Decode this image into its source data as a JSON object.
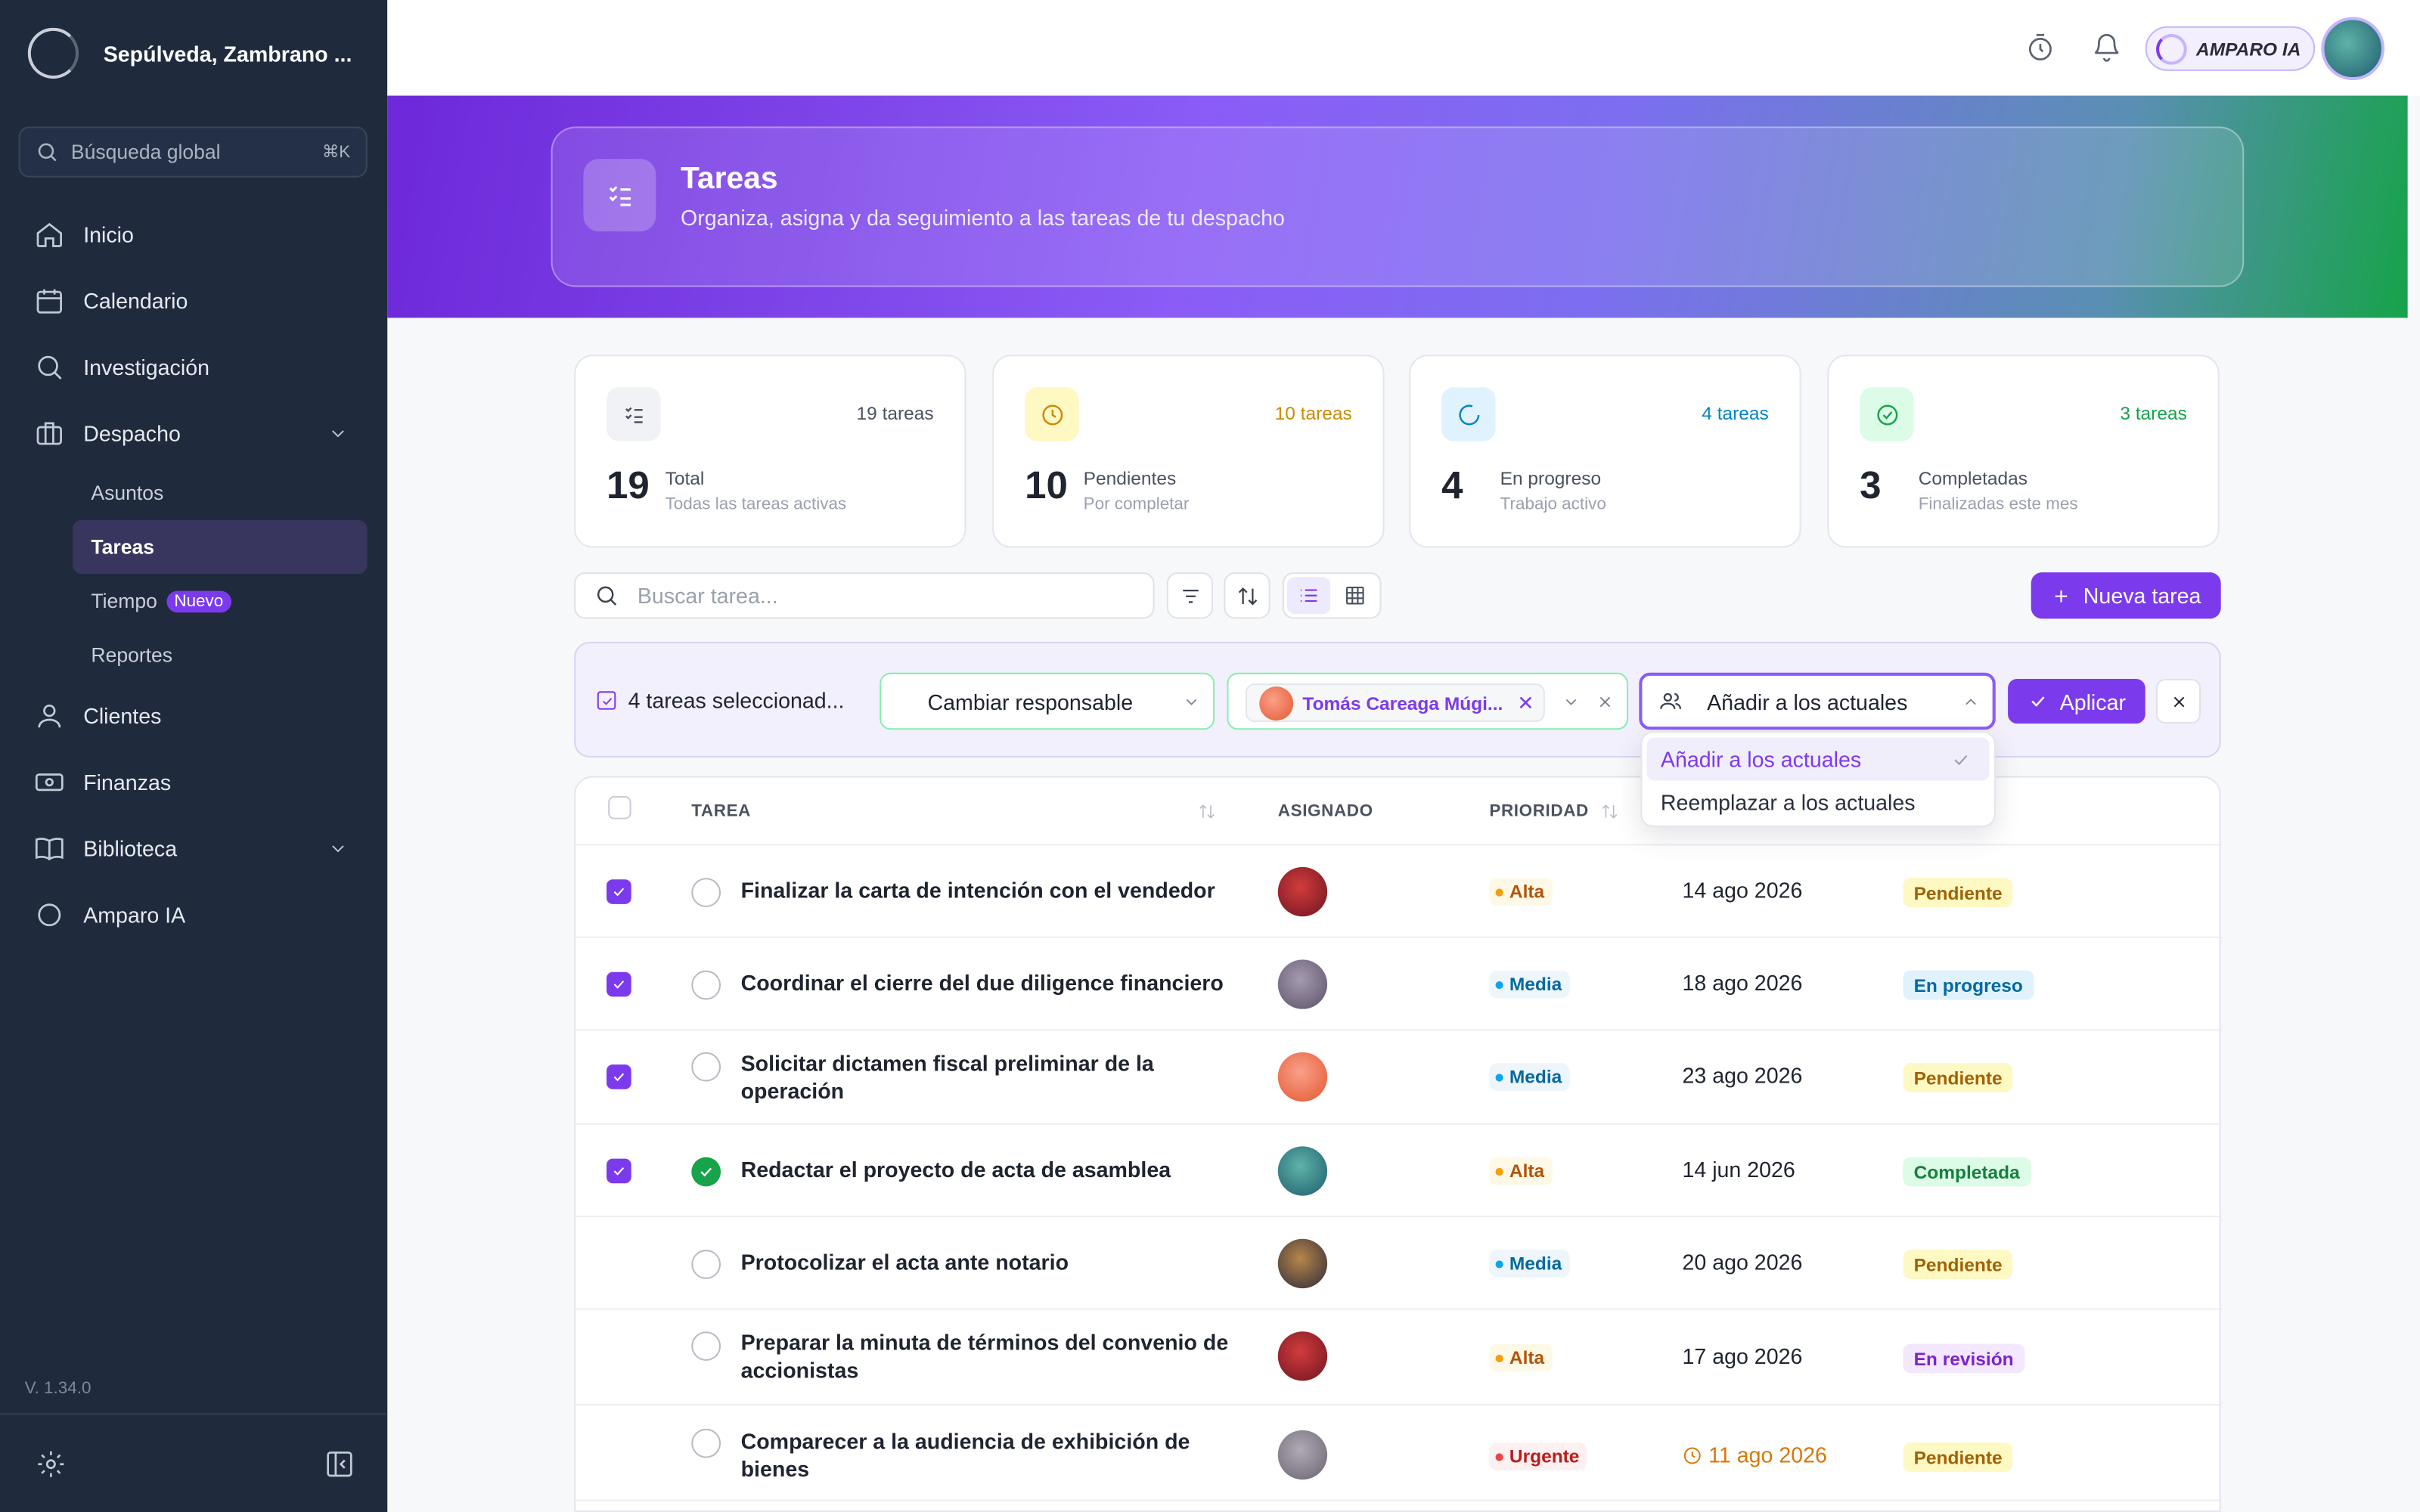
{
  "sidebar": {
    "brand": "Sepúlveda, Zambrano ...",
    "search_label": "Búsqueda global",
    "search_kbd": "⌘K",
    "nav": [
      {
        "label": "Inicio",
        "icon": "home-icon"
      },
      {
        "label": "Calendario",
        "icon": "calendar-icon"
      },
      {
        "label": "Investigación",
        "icon": "search-icon"
      },
      {
        "label": "Despacho",
        "icon": "briefcase-icon"
      }
    ],
    "despacho_sub": [
      {
        "label": "Asuntos"
      },
      {
        "label": "Tareas"
      },
      {
        "label": "Tiempo",
        "badge": "Nuevo"
      },
      {
        "label": "Reportes"
      }
    ],
    "nav2": [
      {
        "label": "Clientes",
        "icon": "user-icon"
      },
      {
        "label": "Finanzas",
        "icon": "cash-icon"
      },
      {
        "label": "Biblioteca",
        "icon": "book-icon"
      },
      {
        "label": "Amparo IA",
        "icon": "ring-icon"
      }
    ],
    "version": "V. 1.34.0"
  },
  "topbar": {
    "amparo_label": "AMPARO IA"
  },
  "hero": {
    "title": "Tareas",
    "subtitle": "Organiza, asigna y da seguimiento a las tareas de tu despacho"
  },
  "stats": [
    {
      "count": "19 tareas",
      "num": "19",
      "label": "Total",
      "sub": "Todas las tareas activas",
      "color": "#4b5260",
      "bg": "#f1f2f5"
    },
    {
      "count": "10 tareas",
      "num": "10",
      "label": "Pendientes",
      "sub": "Por completar",
      "color": "#ca8a04",
      "bg": "#fef9c3"
    },
    {
      "count": "4 tareas",
      "num": "4",
      "label": "En progreso",
      "sub": "Trabajo activo",
      "color": "#0284c7",
      "bg": "#e0f2fe"
    },
    {
      "count": "3 tareas",
      "num": "3",
      "label": "Completadas",
      "sub": "Finalizadas este mes",
      "color": "#16a34a",
      "bg": "#dcfce7"
    }
  ],
  "toolbar": {
    "search_placeholder": "Buscar tarea...",
    "new_task": "Nueva tarea"
  },
  "bulk": {
    "selected_text": "4 tareas seleccionad...",
    "action": "Cambiar responsable",
    "assignee": "Tomás Careaga Múgi...",
    "mode": "Añadir a los actuales",
    "apply": "Aplicar"
  },
  "menu": {
    "options": [
      "Añadir a los actuales",
      "Reemplazar a los actuales"
    ]
  },
  "table": {
    "headers": {
      "task": "TAREA",
      "assigned": "ASIGNADO",
      "priority": "PRIORIDAD"
    },
    "rows": [
      {
        "name": "Finalizar la carta de intención con el vendedor",
        "priority": "Alta",
        "date": "14 ago 2026",
        "status": "Pendiente",
        "checked": true,
        "done": false,
        "overdue": false
      },
      {
        "name": "Coordinar el cierre del due diligence financiero",
        "priority": "Media",
        "date": "18 ago 2026",
        "status": "En progreso",
        "checked": true,
        "done": false,
        "overdue": false
      },
      {
        "name": "Solicitar dictamen fiscal preliminar de la operación",
        "priority": "Media",
        "date": "23 ago 2026",
        "status": "Pendiente",
        "checked": true,
        "done": false,
        "overdue": false
      },
      {
        "name": "Redactar el proyecto de acta de asamblea",
        "priority": "Alta",
        "date": "14 jun 2026",
        "status": "Completada",
        "checked": true,
        "done": true,
        "overdue": false
      },
      {
        "name": "Protocolizar el acta ante notario",
        "priority": "Media",
        "date": "20 ago 2026",
        "status": "Pendiente",
        "checked": false,
        "done": false,
        "overdue": false
      },
      {
        "name": "Preparar la minuta de términos del convenio de accionistas",
        "priority": "Alta",
        "date": "17 ago 2026",
        "status": "En revisión",
        "checked": false,
        "done": false,
        "overdue": false
      },
      {
        "name": "Comparecer a la audiencia de exhibición de bienes",
        "priority": "Urgente",
        "date": "11 ago 2026",
        "status": "Pendiente",
        "checked": false,
        "done": false,
        "overdue": true
      }
    ]
  }
}
